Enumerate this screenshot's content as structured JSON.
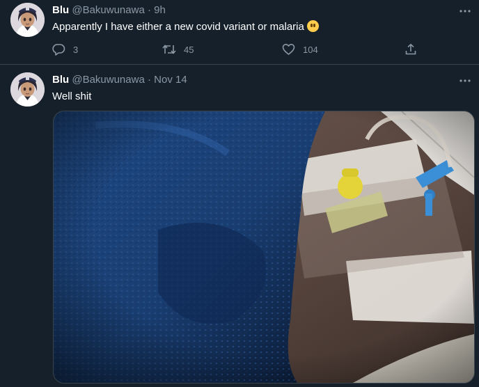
{
  "tweets": [
    {
      "name": "Blu",
      "handle": "@Bakuwunawa",
      "separator": "·",
      "time": "9h",
      "text": "Apparently I have either a new covid variant or malaria",
      "emoji_icon": "face-without-mouth-emoji",
      "replies": "3",
      "retweets": "45",
      "likes": "104"
    },
    {
      "name": "Blu",
      "handle": "@Bakuwunawa",
      "separator": "·",
      "time": "Nov 14",
      "text": "Well shit",
      "media": "photo-of-iv-cannula-in-arm-under-blue-blanket"
    }
  ],
  "colors": {
    "background": "#15202b",
    "border": "#38444d",
    "muted": "#8b98a5",
    "text": "#ffffff"
  }
}
